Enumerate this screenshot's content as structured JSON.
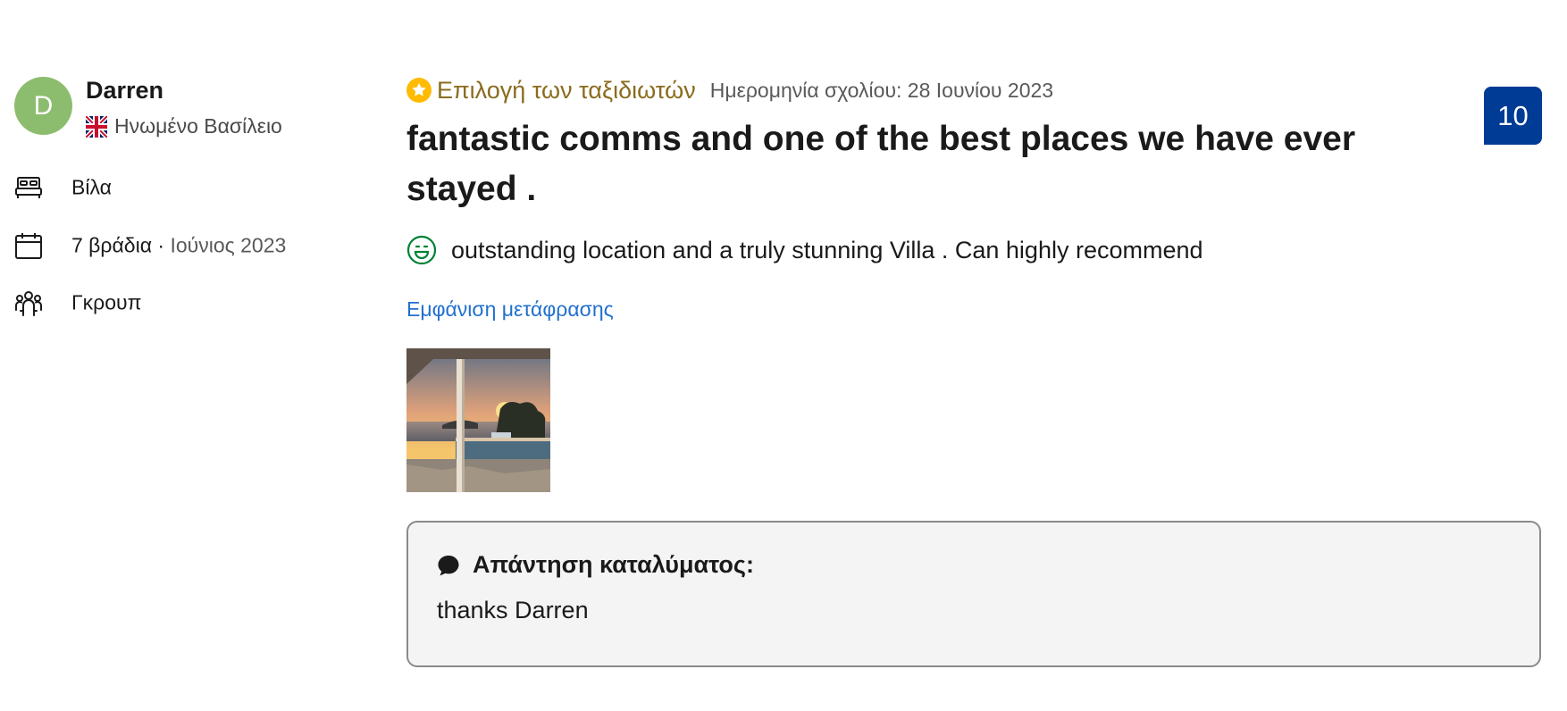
{
  "reviewer": {
    "initial": "D",
    "name": "Darren",
    "country": "Ηνωμένο Βασίλειο",
    "flag_icon": "uk-flag-icon",
    "avatar_color": "#8cbd6e"
  },
  "stay_details": [
    {
      "icon": "bed-icon",
      "text": "Βίλα"
    },
    {
      "icon": "calendar-icon",
      "nights": "7 βράδια",
      "separator": "·",
      "month": "Ιούνιος 2023"
    },
    {
      "icon": "group-icon",
      "text": "Γκρουπ"
    }
  ],
  "review": {
    "badge_icon": "star-icon",
    "badge_label": "Επιλογή των ταξιδιωτών",
    "date": "Ημερομηνία σχολίου: 28 Ιουνίου 2023",
    "title": "fantastic comms and one of the best places we have ever stayed .",
    "positive_icon": "smiley-icon",
    "positive_text": "outstanding location and a truly stunning Villa . Can highly recommend",
    "translation_link": "Εμφάνιση μετάφρασης",
    "score": "10"
  },
  "property_reply": {
    "icon": "speech-bubble-icon",
    "title": "Απάντηση καταλύματος:",
    "text": "thanks Darren"
  },
  "colors": {
    "badge_gold": "#8a6c1e",
    "star_fill": "#febb02",
    "link_blue": "#2170cf",
    "score_blue": "#003b95",
    "positive_green": "#008234"
  }
}
